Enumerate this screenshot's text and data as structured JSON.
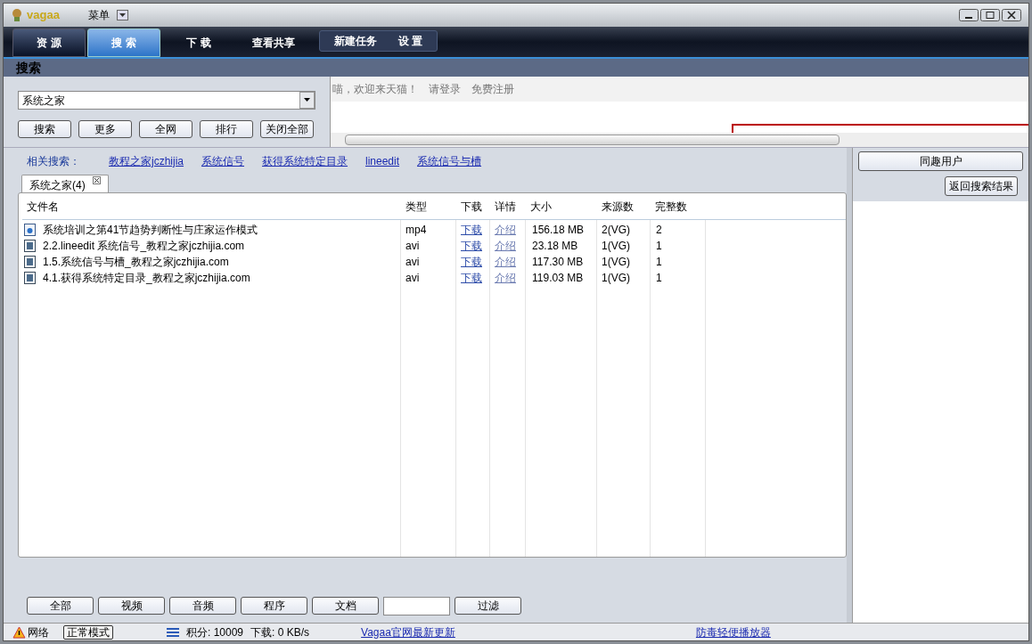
{
  "app": {
    "logo": "vagaa",
    "menu": "菜单"
  },
  "nav_tabs": [
    {
      "label": "资 源",
      "selected": false
    },
    {
      "label": "搜 索",
      "selected": true
    },
    {
      "label": "下 载",
      "selected": false
    },
    {
      "label": "查看共享",
      "selected": false
    }
  ],
  "nav_actions": [
    "新建任务",
    "设 置"
  ],
  "section_title": "搜索",
  "search": {
    "value": "系统之家",
    "buttons": [
      "搜索",
      "更多",
      "全网",
      "排行",
      "关闭全部"
    ]
  },
  "web_panel": {
    "links": [
      "喵，欢迎来天猫！",
      "请登录",
      "免费注册"
    ]
  },
  "related": {
    "label": "相关搜索：",
    "links": [
      "教程之家jczhijia",
      "系统信号",
      "获得系统特定目录",
      "lineedit",
      "系统信号与槽"
    ]
  },
  "result_tabs": [
    {
      "label": "系统之家(4)",
      "selected": true
    }
  ],
  "table": {
    "columns": [
      "文件名",
      "类型",
      "下载",
      "详情",
      "大小",
      "来源数",
      "完整数"
    ],
    "rows": [
      {
        "kind": "audio",
        "name": "系统培训之第41节趋势判断性与庄家运作模式",
        "type": "mp4",
        "download": "下载",
        "detail": "介绍",
        "size": "156.18 MB",
        "sources": "2(VG)",
        "complete": "2"
      },
      {
        "kind": "video",
        "name": "2.2.lineedit 系统信号_教程之家jczhijia.com",
        "type": "avi",
        "download": "下载",
        "detail": "介绍",
        "size": "23.18 MB",
        "sources": "1(VG)",
        "complete": "1"
      },
      {
        "kind": "video",
        "name": "1.5.系统信号与槽_教程之家jczhijia.com",
        "type": "avi",
        "download": "下载",
        "detail": "介绍",
        "size": "117.30 MB",
        "sources": "1(VG)",
        "complete": "1"
      },
      {
        "kind": "video",
        "name": "4.1.获得系统特定目录_教程之家jczhijia.com",
        "type": "avi",
        "download": "下载",
        "detail": "介绍",
        "size": "119.03 MB",
        "sources": "1(VG)",
        "complete": "1"
      }
    ]
  },
  "filters": {
    "buttons": [
      "全部",
      "视频",
      "音频",
      "程序",
      "文档"
    ],
    "apply": "过滤"
  },
  "side_panel": {
    "title": "同趣用户",
    "back": "返回搜索结果"
  },
  "status_bar": {
    "network": "网络",
    "mode": "正常模式",
    "points": "积分: 10009",
    "download": "下载: 0 KB/s",
    "update_link": "Vagaa官网最新更新",
    "player_link": "防毒轻便播放器"
  }
}
